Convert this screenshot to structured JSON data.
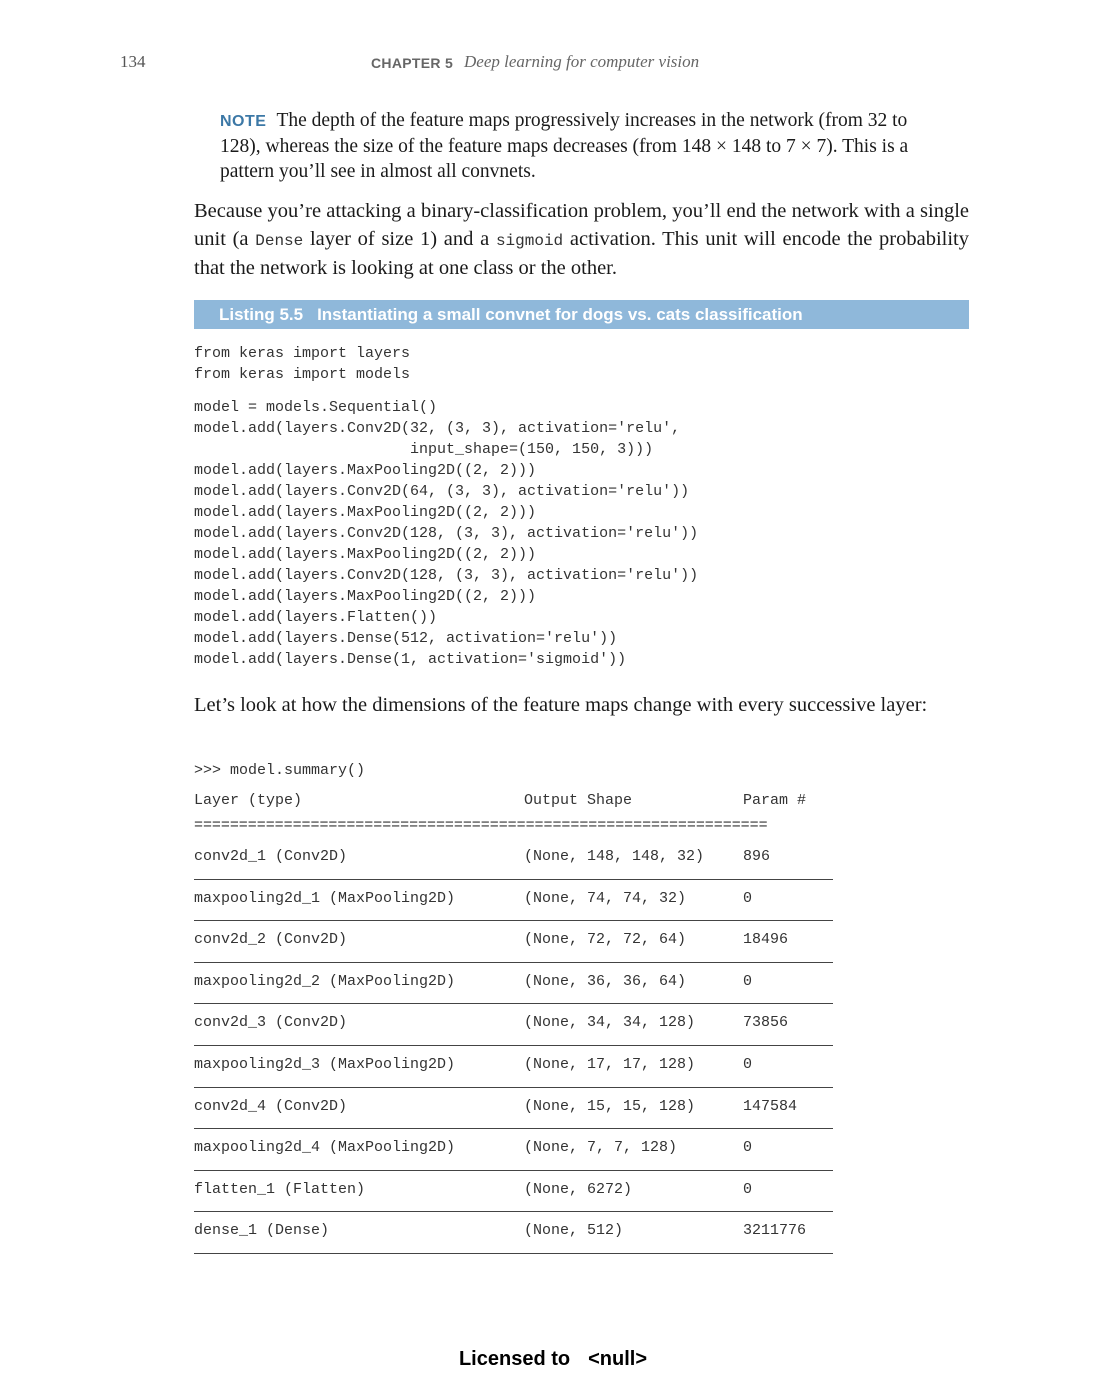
{
  "header": {
    "page_number": "134",
    "chapter_label": "CHAPTER 5",
    "chapter_title": "Deep learning for computer vision"
  },
  "note": {
    "label": "NOTE",
    "text": "The depth of the feature maps progressively increases in the network (from 32 to 128), whereas the size of the feature maps decreases (from 148 × 148 to 7 × 7). This is a pattern you’ll see in almost all convnets."
  },
  "paragraph1": {
    "part1": "Because you’re attacking a binary-classification problem, you’ll end the network with a single unit (a ",
    "code1": "Dense",
    "part2": " layer of size 1) and a ",
    "code2": "sigmoid",
    "part3": " activation. This unit will encode the probability that the network is looking at one class or the other."
  },
  "listing": {
    "number": "Listing 5.5",
    "title": "Instantiating a small convnet for dogs vs. cats classification",
    "imports": "from keras import layers\nfrom keras import models",
    "code": "model = models.Sequential()\nmodel.add(layers.Conv2D(32, (3, 3), activation='relu',\n                        input_shape=(150, 150, 3)))\nmodel.add(layers.MaxPooling2D((2, 2)))\nmodel.add(layers.Conv2D(64, (3, 3), activation='relu'))\nmodel.add(layers.MaxPooling2D((2, 2)))\nmodel.add(layers.Conv2D(128, (3, 3), activation='relu'))\nmodel.add(layers.MaxPooling2D((2, 2)))\nmodel.add(layers.Conv2D(128, (3, 3), activation='relu'))\nmodel.add(layers.MaxPooling2D((2, 2)))\nmodel.add(layers.Flatten())\nmodel.add(layers.Dense(512, activation='relu'))\nmodel.add(layers.Dense(1, activation='sigmoid'))"
  },
  "paragraph2": "Let’s look at how the dimensions of the feature maps change with every successive layer:",
  "summary_call": ">>> model.summary()",
  "summary": {
    "headers": {
      "layer": "Layer (type)",
      "shape": "Output Shape",
      "param": "Param #"
    },
    "separator": "================================================================",
    "rows": [
      {
        "layer": "conv2d_1 (Conv2D)",
        "shape": "(None, 148, 148, 32)",
        "param": "896"
      },
      {
        "layer": "maxpooling2d_1 (MaxPooling2D)",
        "shape": "(None, 74, 74, 32)",
        "param": "0"
      },
      {
        "layer": "conv2d_2 (Conv2D)",
        "shape": "(None, 72, 72, 64)",
        "param": "18496"
      },
      {
        "layer": "maxpooling2d_2 (MaxPooling2D)",
        "shape": "(None, 36, 36, 64)",
        "param": "0"
      },
      {
        "layer": "conv2d_3 (Conv2D)",
        "shape": "(None, 34, 34, 128)",
        "param": "73856"
      },
      {
        "layer": "maxpooling2d_3 (MaxPooling2D)",
        "shape": "(None, 17, 17, 128)",
        "param": "0"
      },
      {
        "layer": "conv2d_4 (Conv2D)",
        "shape": "(None, 15, 15, 128)",
        "param": "147584"
      },
      {
        "layer": "maxpooling2d_4 (MaxPooling2D)",
        "shape": "(None, 7, 7, 128)",
        "param": "0"
      },
      {
        "layer": "flatten_1 (Flatten)",
        "shape": "(None, 6272)",
        "param": "0"
      },
      {
        "layer": "dense_1 (Dense)",
        "shape": "(None, 512)",
        "param": "3211776"
      }
    ]
  },
  "footer": {
    "licensed": "Licensed to",
    "name": "<null>"
  },
  "colors": {
    "note_label": "#3c78a6",
    "listing_bar": "#8fb8da"
  }
}
